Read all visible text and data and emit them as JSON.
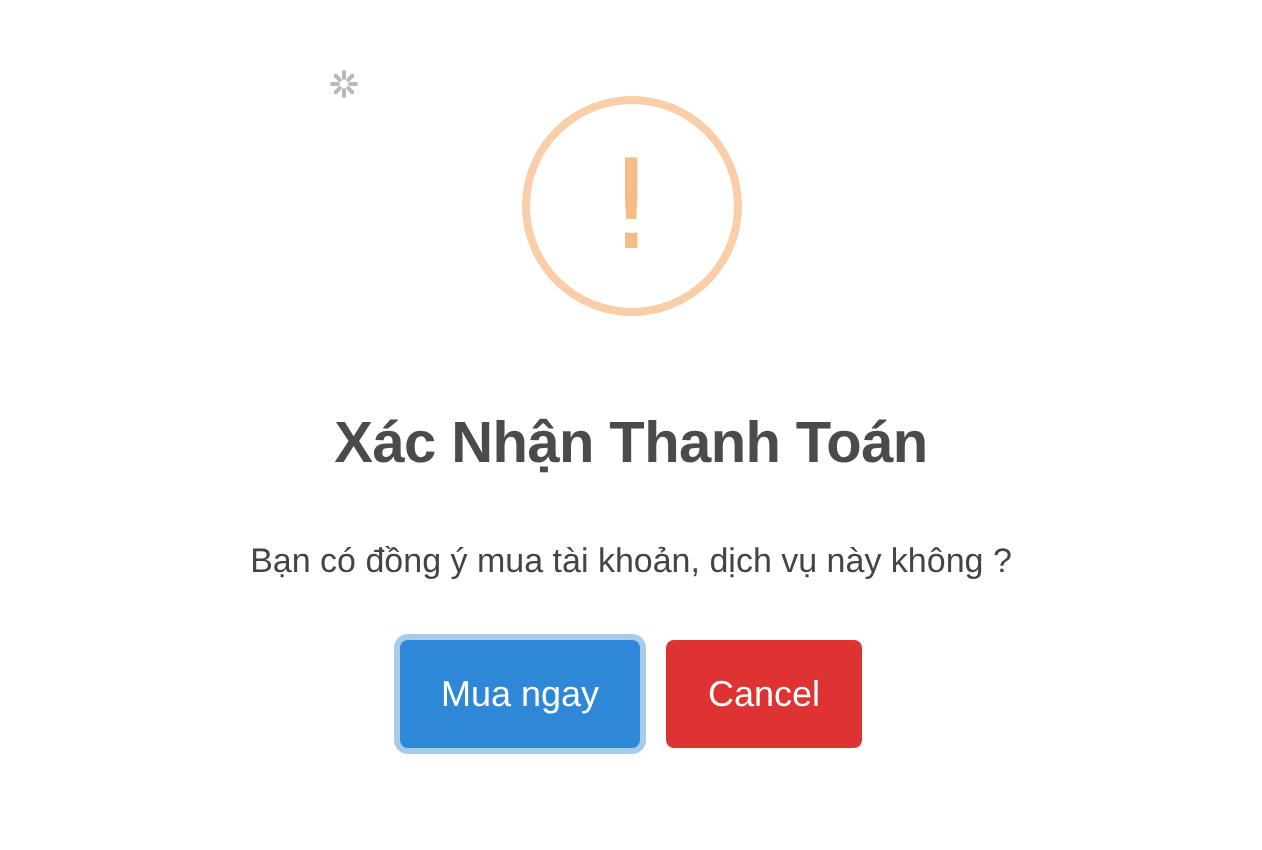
{
  "dialog": {
    "icon_symbol": "!",
    "title": "Xác Nhận Thanh Toán",
    "message": "Bạn có đồng ý mua tài khoản, dịch vụ này không ?",
    "buttons": [
      {
        "label": "Mua ngay",
        "kind": "confirm",
        "focused": true
      },
      {
        "label": "Cancel",
        "kind": "cancel",
        "focused": false
      }
    ]
  }
}
